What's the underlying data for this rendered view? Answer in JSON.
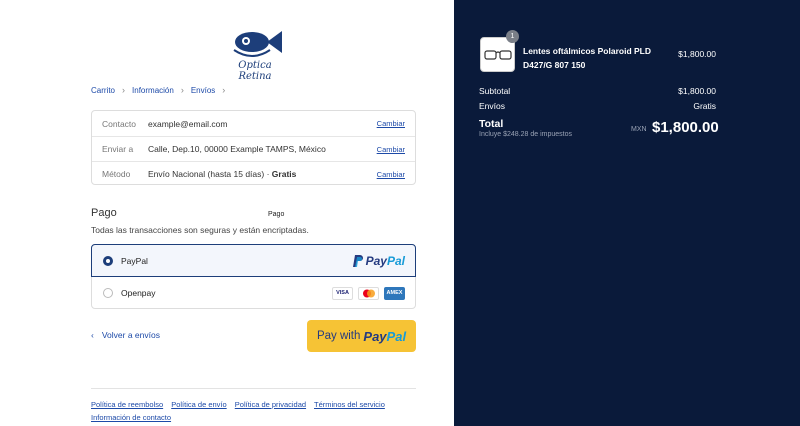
{
  "brand": {
    "name": "Optica Retina"
  },
  "breadcrumb": [
    {
      "label": "Carrito"
    },
    {
      "label": "Información"
    },
    {
      "label": "Envíos"
    },
    {
      "label": "Pago"
    }
  ],
  "review": [
    {
      "label": "Contacto",
      "value": "example@email.com",
      "change": "Cambiar"
    },
    {
      "label": "Enviar a",
      "value": "Calle, Dep.10, 00000 Example TAMPS, México",
      "change": "Cambiar"
    },
    {
      "label": "Método",
      "value": "Envío Nacional (hasta 15 días) · ",
      "value_bold": "Gratis",
      "change": "Cambiar"
    }
  ],
  "payment": {
    "title": "Pago",
    "subtitle": "Todas las transacciones son seguras y están encriptadas.",
    "methods": [
      {
        "name": "PayPal",
        "selected": true,
        "logo_a": "Pay",
        "logo_b": "Pal"
      },
      {
        "name": "Openpay",
        "selected": false,
        "cards": [
          "VISA",
          "MC",
          "AMEX"
        ]
      }
    ]
  },
  "actions": {
    "back": "Volver a envíos",
    "pay_word": "Pay with",
    "pay_a": "Pay",
    "pay_b": "Pal"
  },
  "footer": [
    "Política de reembolso",
    "Política de envío",
    "Política de privacidad",
    "Términos del servicio",
    "Información de contacto"
  ],
  "summary": {
    "item": {
      "name": "Lentes oftálmicos Polaroid PLD D427/G 807 150",
      "price": "$1,800.00",
      "qty": "1"
    },
    "subtotal_label": "Subtotal",
    "subtotal": "$1,800.00",
    "shipping_label": "Envíos",
    "shipping": "Gratis",
    "total_label": "Total",
    "tax_note": "Incluye $248.28 de impuestos",
    "currency": "MXN",
    "total": "$1,800.00"
  },
  "colors": {
    "sidebar": "#0a1a3a",
    "accent": "#1d4aa8",
    "button": "#f6c335"
  }
}
